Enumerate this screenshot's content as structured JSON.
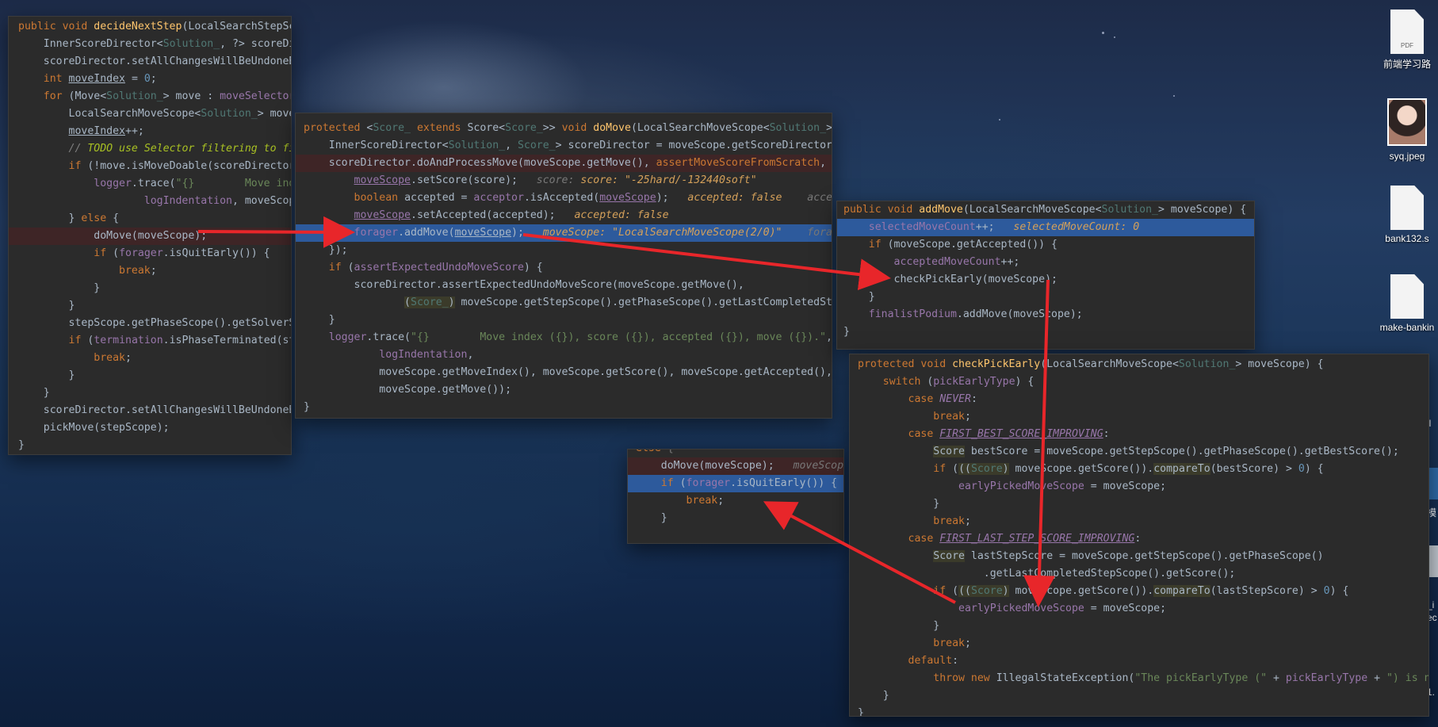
{
  "desktop": {
    "icons": [
      {
        "label": "前端学习路",
        "kind": "pdf-document-icon",
        "badge": "PDF"
      },
      {
        "label": "syq.jpeg",
        "kind": "photo-thumbnail-icon",
        "badge": ""
      },
      {
        "label": "bank132.s",
        "kind": "document-icon",
        "badge": ""
      },
      {
        "label": "make-bankin",
        "kind": "document-icon",
        "badge": ""
      }
    ],
    "partial_labels": [
      "ql",
      "模",
      "_i",
      "ec",
      "1."
    ]
  },
  "panels": {
    "decide_next_step": [
      "public void decideNextStep(LocalSearchStepSc",
      "    InnerScoreDirector<Solution_, ?> scoreDi",
      "    scoreDirector.setAllChangesWillBeUndoneB",
      "    int moveIndex = 0;",
      "    for (Move<Solution_> move : moveSelector",
      "        LocalSearchMoveScope<Solution_> move",
      "        moveIndex++;",
      "        // TODO use Selector filtering to fi",
      "        if (!move.isMoveDoable(scoreDirector",
      "            logger.trace(\"{}        Move ind",
      "                    logIndentation, moveScop",
      "        } else {",
      "            doMove(moveScope);",
      "            if (forager.isQuitEarly()) {",
      "                break;",
      "            }",
      "        }",
      "        stepScope.getPhaseScope().getSolverS",
      "        if (termination.isPhaseTerminated(st",
      "            break;",
      "        }",
      "    }",
      "    scoreDirector.setAllChangesWillBeUndoneB",
      "    pickMove(stepScope);",
      "}"
    ],
    "do_move": [
      "protected <Score_ extends Score<Score_>> void doMove(LocalSearchMoveScope<Solution_> m",
      "    InnerScoreDirector<Solution_, Score_> scoreDirector = moveScope.getScoreDirector(",
      "    scoreDirector.doAndProcessMove(moveScope.getMove(), assertMoveScoreFromScratch, sc",
      "        moveScope.setScore(score);",
      "        boolean accepted = acceptor.isAccepted(moveScope);",
      "        moveScope.setAccepted(accepted);",
      "        forager.addMove(moveScope);",
      "    });",
      "    if (assertExpectedUndoMoveScore) {",
      "        scoreDirector.assertExpectedUndoMoveScore(moveScope.getMove(),",
      "                (Score_) moveScope.getStepScope().getPhaseScope().getLastCompletedStep",
      "    }",
      "    logger.trace(\"{}        Move index ({}), score ({}), accepted ({}), move ({}).\",",
      "            logIndentation,",
      "            moveScope.getMoveIndex(), moveScope.getScore(), moveScope.getAccepted(),",
      "            moveScope.getMove());",
      "}"
    ],
    "do_move_hints": {
      "score": "score: \"-25hard/-132440soft\"",
      "accepted": "accepted: false",
      "accepted2": "accepte",
      "accepted_set": "accepted: false",
      "move_scope": "moveScope: \"LocalSearchMoveScope(2/0)\"",
      "forager": "forage"
    },
    "add_move": [
      "public void addMove(LocalSearchMoveScope<Solution_> moveScope) {",
      "    selectedMoveCount++;",
      "    if (moveScope.getAccepted()) {",
      "        acceptedMoveCount++;",
      "        checkPickEarly(moveScope);",
      "    }",
      "    finalistPodium.addMove(moveScope);",
      "}"
    ],
    "add_move_hint": "selectedMoveCount: 0",
    "mini_panel": [
      "else {",
      "    doMove(moveScope);",
      "    if (forager.isQuitEarly()) {",
      "        break;",
      "    }"
    ],
    "mini_hints": {
      "move_scope": "moveScope:",
      "f": "f"
    },
    "check_pick_early": [
      "protected void checkPickEarly(LocalSearchMoveScope<Solution_> moveScope) {",
      "    switch (pickEarlyType) {",
      "        case NEVER:",
      "            break;",
      "        case FIRST_BEST_SCORE_IMPROVING:",
      "            Score bestScore = moveScope.getStepScope().getPhaseScope().getBestScore();",
      "            if (((Score) moveScope.getScore()).compareTo(bestScore) > 0) {",
      "                earlyPickedMoveScope = moveScope;",
      "            }",
      "            break;",
      "        case FIRST_LAST_STEP_SCORE_IMPROVING:",
      "            Score lastStepScore = moveScope.getStepScope().getPhaseScope()",
      "                    .getLastCompletedStepScope().getScore();",
      "            if (((Score) moveScope.getScore()).compareTo(lastStepScore) > 0) {",
      "                earlyPickedMoveScope = moveScope;",
      "            }",
      "            break;",
      "        default:",
      "            throw new IllegalStateException(\"The pickEarlyType (\" + pickEarlyType + \") is no",
      "    }",
      "}"
    ]
  },
  "colors": {
    "editor_bg": "#2b2b2b",
    "keyword": "#cc7832",
    "method": "#ffc66d",
    "field": "#9876aa",
    "string": "#6a8759",
    "number": "#6897bb",
    "highlight": "#2d5a9c",
    "breakpoint_line": "#3e2526",
    "arrow": "#e8262a"
  }
}
